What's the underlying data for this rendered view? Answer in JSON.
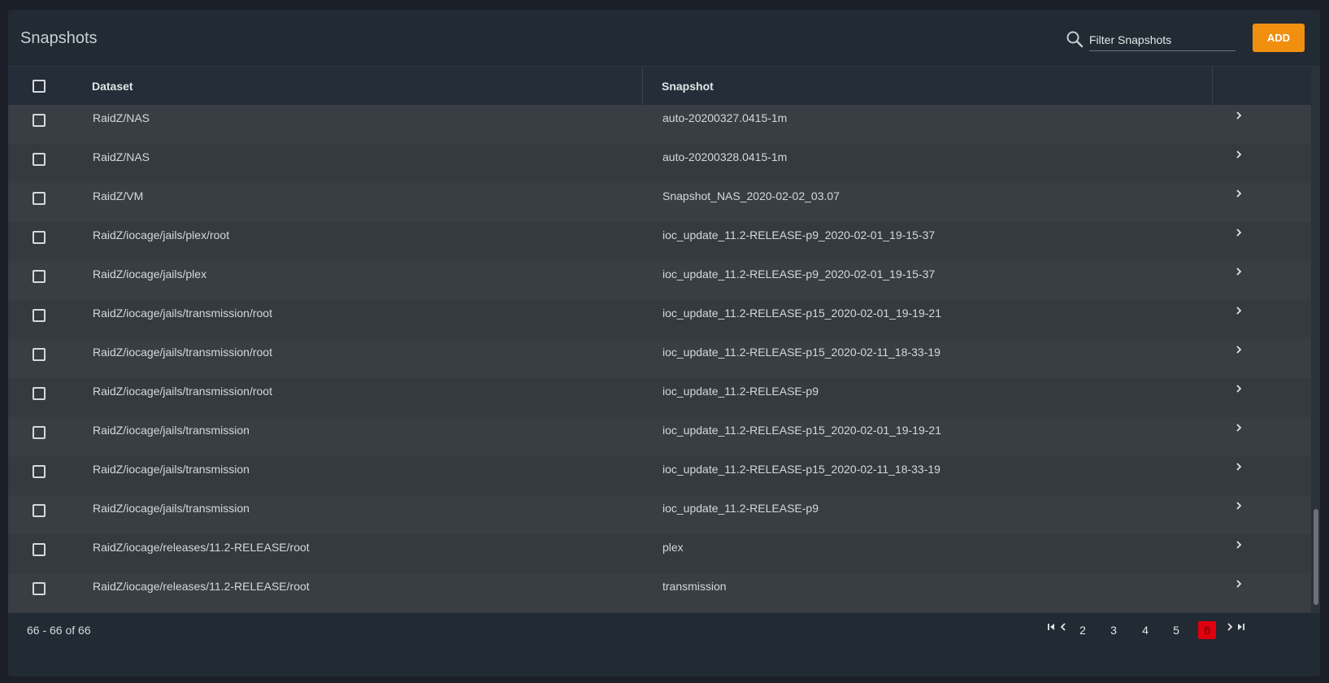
{
  "header": {
    "title": "Snapshots",
    "filter_placeholder": "Filter Snapshots",
    "add_label": "ADD"
  },
  "columns": {
    "dataset": "Dataset",
    "snapshot": "Snapshot"
  },
  "rows": [
    {
      "dataset": "RaidZ/NAS",
      "snapshot": "auto-20200327.0415-1m"
    },
    {
      "dataset": "RaidZ/NAS",
      "snapshot": "auto-20200328.0415-1m"
    },
    {
      "dataset": "RaidZ/VM",
      "snapshot": "Snapshot_NAS_2020-02-02_03.07"
    },
    {
      "dataset": "RaidZ/iocage/jails/plex/root",
      "snapshot": "ioc_update_11.2-RELEASE-p9_2020-02-01_19-15-37"
    },
    {
      "dataset": "RaidZ/iocage/jails/plex",
      "snapshot": "ioc_update_11.2-RELEASE-p9_2020-02-01_19-15-37"
    },
    {
      "dataset": "RaidZ/iocage/jails/transmission/root",
      "snapshot": "ioc_update_11.2-RELEASE-p15_2020-02-01_19-19-21"
    },
    {
      "dataset": "RaidZ/iocage/jails/transmission/root",
      "snapshot": "ioc_update_11.2-RELEASE-p15_2020-02-11_18-33-19"
    },
    {
      "dataset": "RaidZ/iocage/jails/transmission/root",
      "snapshot": "ioc_update_11.2-RELEASE-p9"
    },
    {
      "dataset": "RaidZ/iocage/jails/transmission",
      "snapshot": "ioc_update_11.2-RELEASE-p15_2020-02-01_19-19-21"
    },
    {
      "dataset": "RaidZ/iocage/jails/transmission",
      "snapshot": "ioc_update_11.2-RELEASE-p15_2020-02-11_18-33-19"
    },
    {
      "dataset": "RaidZ/iocage/jails/transmission",
      "snapshot": "ioc_update_11.2-RELEASE-p9"
    },
    {
      "dataset": "RaidZ/iocage/releases/11.2-RELEASE/root",
      "snapshot": "plex"
    },
    {
      "dataset": "RaidZ/iocage/releases/11.2-RELEASE/root",
      "snapshot": "transmission"
    }
  ],
  "footer": {
    "range_label": "66 - 66 of 66",
    "pages": [
      "2",
      "3",
      "4",
      "5",
      "6"
    ],
    "active_page": "6"
  },
  "colors": {
    "accent": "#f0900e",
    "active_page": "#e0000e"
  },
  "icons": {
    "search": "search-icon",
    "row_action": "chevron-right-icon",
    "first_page": "first-page-icon",
    "prev_page": "chevron-left-icon",
    "next_page": "chevron-right-icon",
    "last_page": "last-page-icon"
  }
}
